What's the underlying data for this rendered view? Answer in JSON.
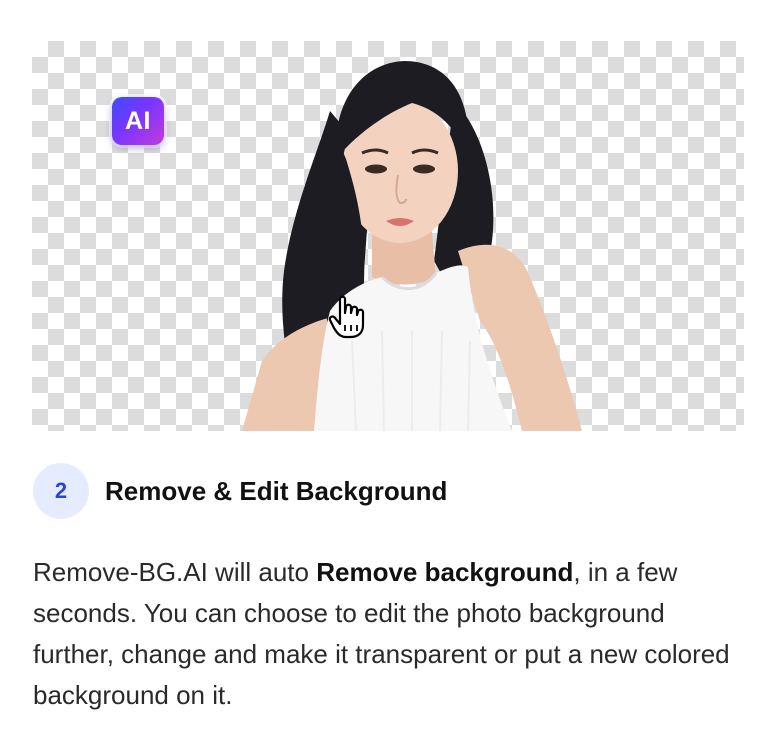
{
  "badge": {
    "label": "AI"
  },
  "step": {
    "number": "2",
    "title": "Remove & Edit Background"
  },
  "description": {
    "part1": "Remove-BG.AI will auto ",
    "bold": "Remove background",
    "part2": ", in a few seconds. You can choose to edit the photo background further, change and make it transparent or put a new colored background on it."
  },
  "colors": {
    "step_badge_bg": "#e6ecff",
    "step_badge_text": "#2847d6",
    "ai_gradient_start": "#3b4dff",
    "ai_gradient_end": "#c23cd8"
  },
  "icons": [
    "ai-badge-icon",
    "hand-pointer-icon"
  ]
}
